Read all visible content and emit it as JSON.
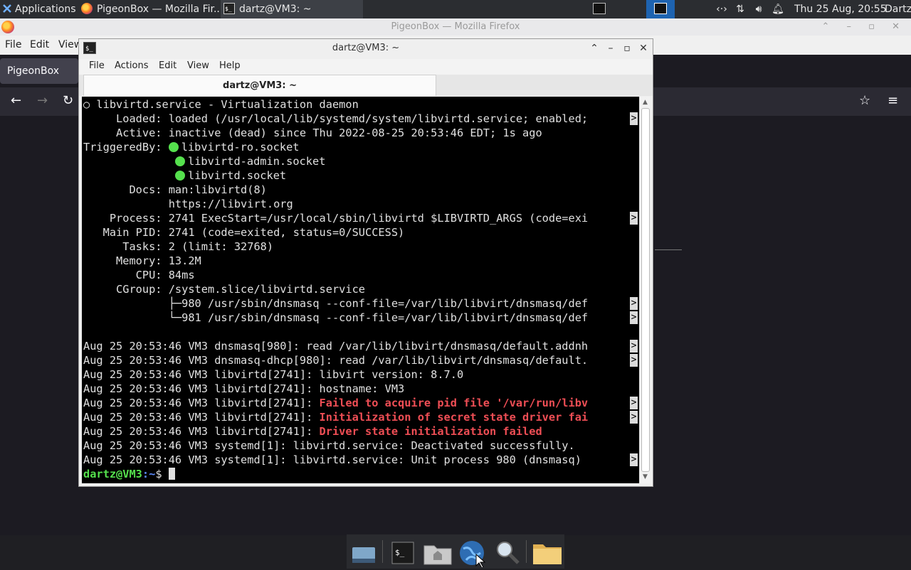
{
  "top_panel": {
    "applications_label": "Applications",
    "tasks": [
      {
        "label": "PigeonBox — Mozilla Fir...",
        "icon": "firefox-icon"
      },
      {
        "label": "dartz@VM3: ~",
        "icon": "terminal-icon"
      }
    ],
    "clock": "Thu 25 Aug, 20:55",
    "user": "Dartz",
    "tray_icons": [
      "network-icon",
      "transfer-icon",
      "volume-icon",
      "notification-icon"
    ]
  },
  "firefox": {
    "window_title": "PigeonBox — Mozilla Firefox",
    "menu": {
      "file": "File",
      "edit": "Edit",
      "view": "View"
    },
    "tab_title": "PigeonBox"
  },
  "terminal": {
    "window_title": "dartz@VM3: ~",
    "menu": {
      "file": "File",
      "actions": "Actions",
      "edit": "Edit",
      "view": "View",
      "help": "Help"
    },
    "tab_title": "dartz@VM3: ~",
    "lines": [
      "○ libvirtd.service - Virtualization daemon",
      "     Loaded: loaded (/usr/local/lib/systemd/system/libvirtd.service; enabled;",
      "     Active: inactive (dead) since Thu 2022-08-25 20:53:46 EDT; 1s ago",
      "libvirtd-ro.socket",
      "libvirtd-admin.socket",
      "libvirtd.socket",
      "       Docs: man:libvirtd(8)",
      "             https://libvirt.org",
      "    Process: 2741 ExecStart=/usr/local/sbin/libvirtd $LIBVIRTD_ARGS (code=exi",
      "   Main PID: 2741 (code=exited, status=0/SUCCESS)",
      "      Tasks: 2 (limit: 32768)",
      "     Memory: 13.2M",
      "        CPU: 84ms",
      "     CGroup: /system.slice/libvirtd.service",
      "             ├─980 /usr/sbin/dnsmasq --conf-file=/var/lib/libvirt/dnsmasq/def",
      "             └─981 /usr/sbin/dnsmasq --conf-file=/var/lib/libvirt/dnsmasq/def",
      "Aug 25 20:53:46 VM3 dnsmasq[980]: read /var/lib/libvirt/dnsmasq/default.addnh",
      "Aug 25 20:53:46 VM3 dnsmasq-dhcp[980]: read /var/lib/libvirt/dnsmasq/default.",
      "Aug 25 20:53:46 VM3 libvirtd[2741]: libvirt version: 8.7.0",
      "Aug 25 20:53:46 VM3 libvirtd[2741]: hostname: VM3",
      "Aug 25 20:53:46 VM3 libvirtd[2741]: ",
      "Failed to acquire pid file '/var/run/libv",
      "Aug 25 20:53:46 VM3 libvirtd[2741]: ",
      "Initialization of secret state driver fai",
      "Aug 25 20:53:46 VM3 libvirtd[2741]: ",
      "Driver state initialization failed",
      "Aug 25 20:53:46 VM3 systemd[1]: libvirtd.service: Deactivated successfully.",
      "Aug 25 20:53:46 VM3 systemd[1]: libvirtd.service: Unit process 980 (dnsmasq) "
    ],
    "triggered_label": "TriggeredBy: ",
    "prompt_user": "dartz@VM3",
    "prompt_path": ":~",
    "prompt_sym": "$ ",
    "truncation_marker": ">"
  },
  "dock": {
    "items": [
      "show-desktop-icon",
      "terminal-icon",
      "home-folder-icon",
      "web-browser-icon",
      "search-icon",
      "folder-icon"
    ]
  },
  "colors": {
    "error_red": "#ef4e55",
    "prompt_green": "#55e04d",
    "active_workspace": "#1e63b0"
  }
}
